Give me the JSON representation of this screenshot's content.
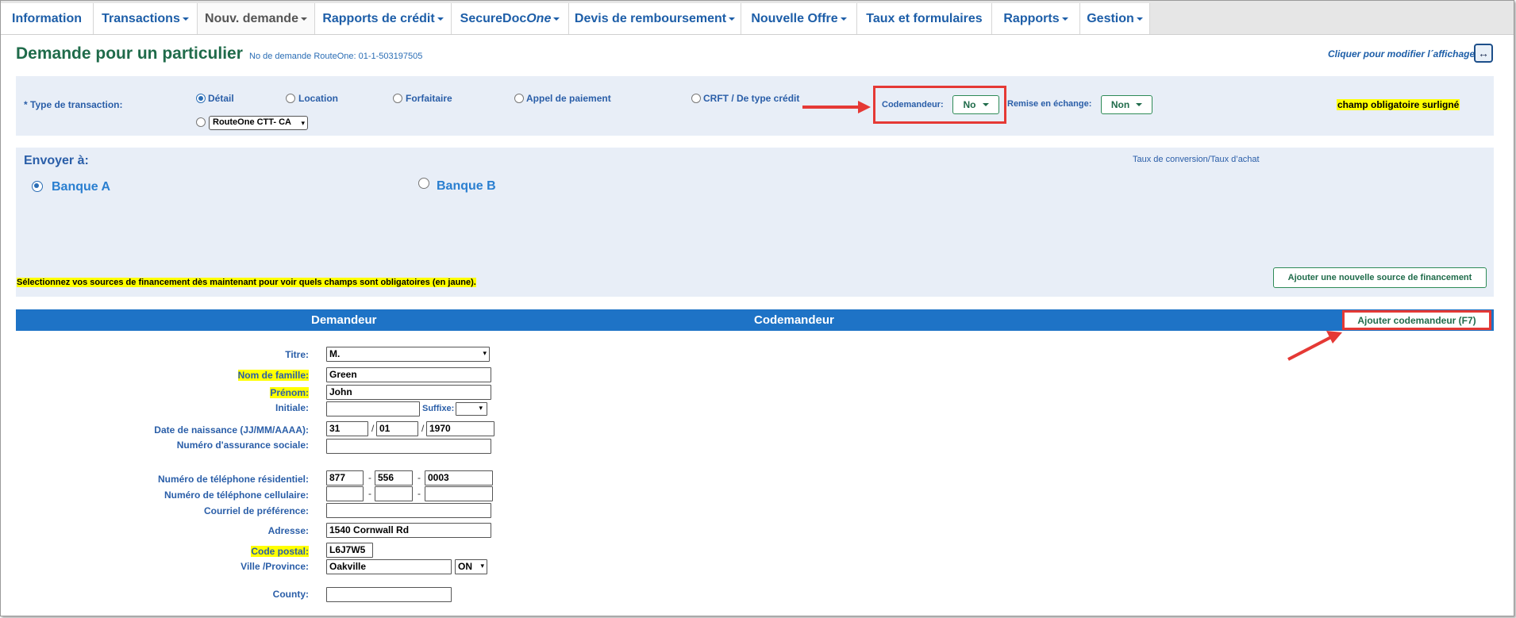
{
  "nav": {
    "tabs": [
      {
        "label": "Information",
        "dropdown": false
      },
      {
        "label": "Transactions",
        "dropdown": true
      },
      {
        "label": "Nouv. demande",
        "dropdown": true,
        "active": true
      },
      {
        "label": "Rapports de crédit",
        "dropdown": true
      },
      {
        "label": "SecureDoc",
        "label_italic": "One",
        "dropdown": true
      },
      {
        "label": "Devis de remboursement",
        "dropdown": true
      },
      {
        "label": "Nouvelle Offre",
        "dropdown": true
      },
      {
        "label": "Taux et formulaires",
        "dropdown": false
      },
      {
        "label": "Rapports",
        "dropdown": true
      },
      {
        "label": "Gestion",
        "dropdown": true
      }
    ]
  },
  "header": {
    "title": "Demande pour un particulier",
    "request_no": "No de demande RouteOne: 01-1-503197505",
    "toggle_view": "Cliquer pour modifier l´affichage",
    "toggle_icon": "↔"
  },
  "transaction": {
    "label": "* Type de transaction:",
    "options": [
      {
        "label": "Détail",
        "selected": true
      },
      {
        "label": "Location",
        "selected": false
      },
      {
        "label": "Forfaitaire",
        "selected": false
      },
      {
        "label": "Appel de paiement",
        "selected": false
      },
      {
        "label": "CRFT / De type crédit",
        "selected": false
      }
    ],
    "routeone_select": "RouteOne CTT- CA",
    "coapplicant_label": "Codemandeur:",
    "coapplicant_value": "No",
    "tradein_label": "Remise en échange:",
    "tradein_value": "Non",
    "required_note": "champ obligatoire surligné"
  },
  "send_to": {
    "label": "Envoyer à:",
    "banks": [
      {
        "label": "Banque A",
        "selected": true
      },
      {
        "label": "Banque B",
        "selected": false
      }
    ],
    "conversion": "Taux de conversion/Taux d’achat",
    "financing_note": "Sélectionnez vos sources de financement dès maintenant pour voir quels champs sont obligatoires (en jaune).",
    "add_source_button": "Ajouter une nouvelle source de financement"
  },
  "applicant_bar": {
    "applicant": "Demandeur",
    "coapplicant": "Codemandeur",
    "add_coapplicant_button": "Ajouter codemandeur  (F7)"
  },
  "form": {
    "titre_label": "Titre:",
    "titre_value": "M.",
    "nom_label": "Nom de famille:",
    "nom_value": "Green",
    "prenom_label": "Prénom:",
    "prenom_value": "John",
    "initiale_label": "Initiale:",
    "initiale_value": "",
    "suffixe_label": "Suffixe:",
    "dob_label": "Date de naissance (JJ/MM/AAAA):",
    "dob_day": "31",
    "dob_month": "01",
    "dob_year": "1970",
    "sin_label": "Numéro d'assurance sociale:",
    "home_phone_label": "Numéro de téléphone résidentiel:",
    "home_phone": [
      "877",
      "556",
      "0003"
    ],
    "cell_phone_label": "Numéro de téléphone cellulaire:",
    "email_label": "Courriel de préférence:",
    "address_label": "Adresse:",
    "address_value": "1540 Cornwall Rd",
    "postal_label": "Code postal:",
    "postal_value": "L6J7W5",
    "city_label": "Ville /Province:",
    "city_value": "Oakville",
    "province_value": "ON",
    "county_label": "County:",
    "slash": "/",
    "dash": "-"
  },
  "colors": {
    "nav_text": "#1d5ea8",
    "title_green": "#1f6b4a",
    "panel_bg": "#e8eef7",
    "bar_blue": "#1e73c6",
    "highlight_red": "#e53935",
    "required_yellow": "#ffff00"
  }
}
